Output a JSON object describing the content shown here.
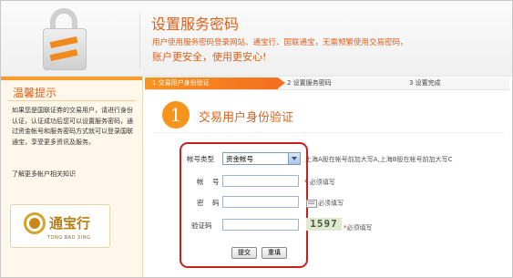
{
  "header": {
    "title": "设置服务密码",
    "subtitle": "用户使用服务密码登录网站、通宝行、国联通宝，无需频繁使用交易密码，",
    "slogan": "账户更安全，使用更安心!",
    "icon": "lock-icon"
  },
  "sidebar": {
    "title": "温馨提示",
    "body": "如果您是国联证券的交易用户，请进行身份认证，认证成功后您可以设置服务密码，通过资金帐号和服务密码方式就可以登录国联通宝，享受更多资讯及服务。",
    "link": "了解更多帐户相关知识",
    "logo": {
      "name": "通宝行",
      "sub": "TONG BAO XING"
    }
  },
  "steps": [
    {
      "label": "1  交易用户身份验证",
      "active": true
    },
    {
      "label": "2  设置服务密码",
      "active": false
    },
    {
      "label": "3  设置完成",
      "active": false
    }
  ],
  "section": {
    "number": "1",
    "title": "交易用户身份验证"
  },
  "form": {
    "account_type_label": "帐号类型",
    "account_type_value": "资金帐号",
    "account_type_hint": "上海A股在帐号前加大写A,上海B股在帐号前加大写C",
    "account_label": "帐    号",
    "account_value": "",
    "account_hint": "必须填写",
    "password_label": "密    码",
    "password_value": "",
    "password_hint": "必须填写",
    "captcha_label": "验证码",
    "captcha_value": "",
    "captcha_code": "1597",
    "captcha_hint": "必须填写",
    "required_mark": "*",
    "submit_label": "提交",
    "reset_label": "重填"
  },
  "colors": {
    "accent": "#e0601a",
    "step_active": "#f7941d",
    "form_border": "#c8201c",
    "sidebar_bg": "#fff8ea"
  }
}
